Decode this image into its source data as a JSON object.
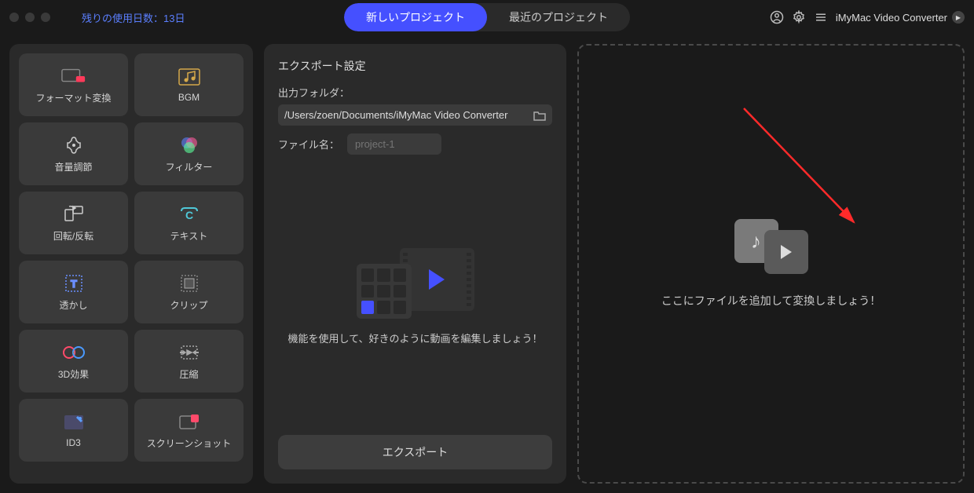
{
  "titlebar": {
    "trial_text": "残りの使用日数：13日",
    "app_name": "iMyMac Video Converter"
  },
  "tabs": {
    "new_project": "新しいプロジェクト",
    "recent_projects": "最近のプロジェクト"
  },
  "sidebar": {
    "tiles": [
      {
        "label": "フォーマット変換"
      },
      {
        "label": "BGM"
      },
      {
        "label": "音量調節"
      },
      {
        "label": "フィルター"
      },
      {
        "label": "回転/反転"
      },
      {
        "label": "テキスト"
      },
      {
        "label": "透かし"
      },
      {
        "label": "クリップ"
      },
      {
        "label": "3D効果"
      },
      {
        "label": "圧縮"
      },
      {
        "label": "ID3"
      },
      {
        "label": "スクリーンショット"
      }
    ]
  },
  "center": {
    "title": "エクスポート設定",
    "output_folder_label": "出力フォルダ：",
    "output_folder_path": "/Users/zoen/Documents/iMyMac Video Converter",
    "filename_label": "ファイル名：",
    "filename_placeholder": "project-1",
    "hint": "機能を使用して、好きのように動画を編集しましょう！",
    "export_button": "エクスポート"
  },
  "dropzone": {
    "text": "ここにファイルを追加して変換しましょう！"
  }
}
